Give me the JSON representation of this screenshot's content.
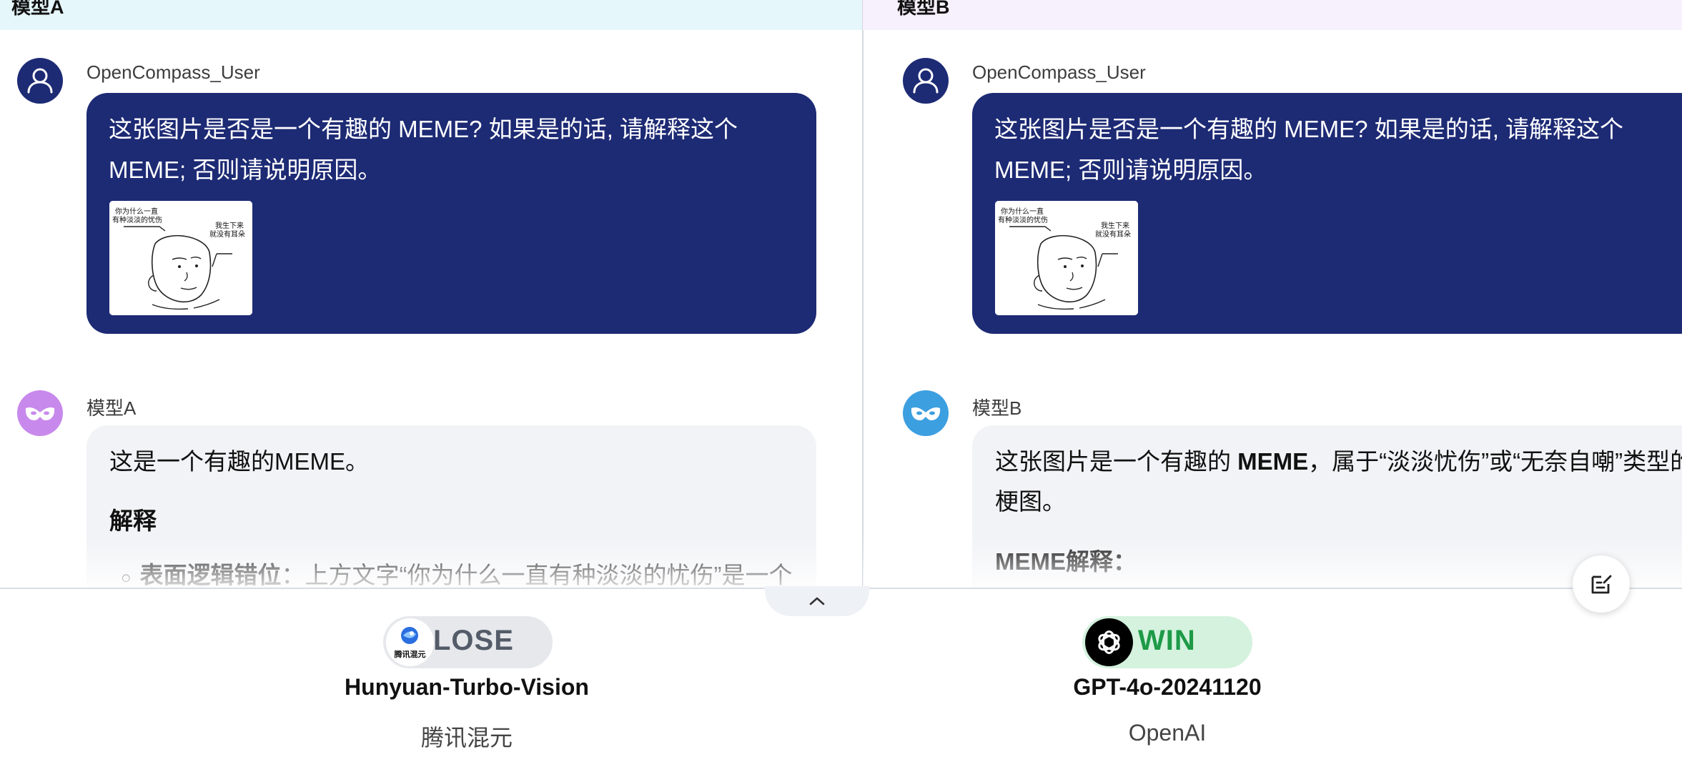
{
  "pane_a": {
    "header_title": "模型A",
    "user_name": "OpenCompass_User",
    "user_message": "这张图片是否是一个有趣的 MEME? 如果是的话, 请解释这个 MEME; 否则请说明原因。",
    "model_name": "模型A",
    "response": {
      "line1": "这是一个有趣的MEME。",
      "heading": "解释",
      "bullet_bold": "表面逻辑错位",
      "bullet_text": "：上方文字“你为什么一直有种淡淡的忧伤”是一个"
    }
  },
  "pane_b": {
    "header_title": "模型B",
    "user_name": "OpenCompass_User",
    "user_message": "这张图片是否是一个有趣的 MEME? 如果是的话, 请解释这个 MEME; 否则请说明原因。",
    "model_name": "模型B",
    "response": {
      "line1_prefix": "这张图片是一个有趣的 ",
      "line1_bold": "MEME",
      "line1_suffix": "，属于“淡淡忧伤”或“无奈自嘲”类型的",
      "line2": "梗图。",
      "heading": "MEME解释："
    }
  },
  "meme_image": {
    "left_caption_line1": "你为什么一直",
    "left_caption_line2": "有种淡淡的忧伤",
    "right_caption_line1": "我生下来",
    "right_caption_line2": "就没有耳朵"
  },
  "results": {
    "left": {
      "badge": "LOSE",
      "logo_text": "腾讯混元",
      "model": "Hunyuan-Turbo-Vision",
      "org": "腾讯混元"
    },
    "right": {
      "badge": "WIN",
      "model": "GPT-4o-20241120",
      "org": "OpenAI"
    }
  },
  "colors": {
    "user_bubble": "#1d2a74",
    "model_bubble": "#f2f3f6",
    "win": "#1e9a47",
    "lose": "#535c68"
  },
  "icons": {
    "user_avatar": "user-icon",
    "model_a_avatar": "mask-icon",
    "model_b_avatar": "mask-icon",
    "collapse": "chevron-up-icon",
    "edit": "edit-note-icon"
  }
}
